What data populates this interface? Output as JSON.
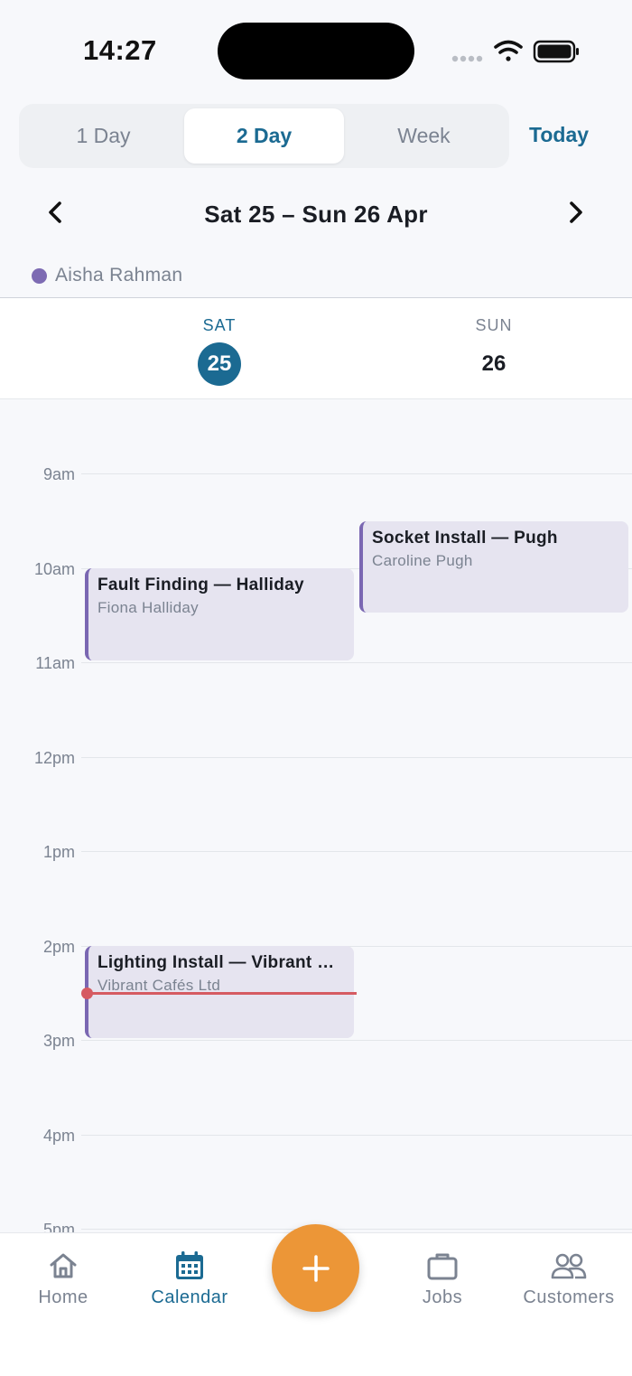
{
  "status_bar": {
    "time": "14:27"
  },
  "view_switcher": {
    "options": [
      "1 Day",
      "2 Day",
      "Week"
    ],
    "selected": "2 Day",
    "today_label": "Today"
  },
  "date_nav": {
    "title": "Sat 25 – Sun 26 Apr"
  },
  "resource": {
    "name": "Aisha Rahman",
    "color": "#7d6bb3"
  },
  "days": [
    {
      "name": "SAT",
      "number": "25",
      "selected": true
    },
    {
      "name": "SUN",
      "number": "26",
      "selected": false
    }
  ],
  "hours": [
    "9am",
    "10am",
    "11am",
    "12pm",
    "1pm",
    "2pm",
    "3pm",
    "4pm",
    "5pm"
  ],
  "events": [
    {
      "title": "Fault Finding — Halliday",
      "subtitle": "Fiona Halliday",
      "day": "SAT"
    },
    {
      "title": "Socket Install — Pugh",
      "subtitle": "Caroline Pugh",
      "day": "SUN"
    },
    {
      "title": "Lighting Install — Vibrant Cafés Ltd",
      "subtitle": "Vibrant Cafés Ltd",
      "day": "SAT"
    }
  ],
  "tabs": [
    {
      "label": "Home",
      "icon": "home-icon",
      "active": false
    },
    {
      "label": "Calendar",
      "icon": "calendar-icon",
      "active": true
    },
    {
      "label": "Jobs",
      "icon": "briefcase-icon",
      "active": false
    },
    {
      "label": "Customers",
      "icon": "people-icon",
      "active": false
    }
  ],
  "fab": {
    "icon": "plus-icon"
  },
  "colors": {
    "accent": "#1b6a92",
    "event_fill": "#e6e4f0",
    "event_border": "#7a67b2",
    "now_line": "#d65b62",
    "fab": "#ec9637"
  }
}
